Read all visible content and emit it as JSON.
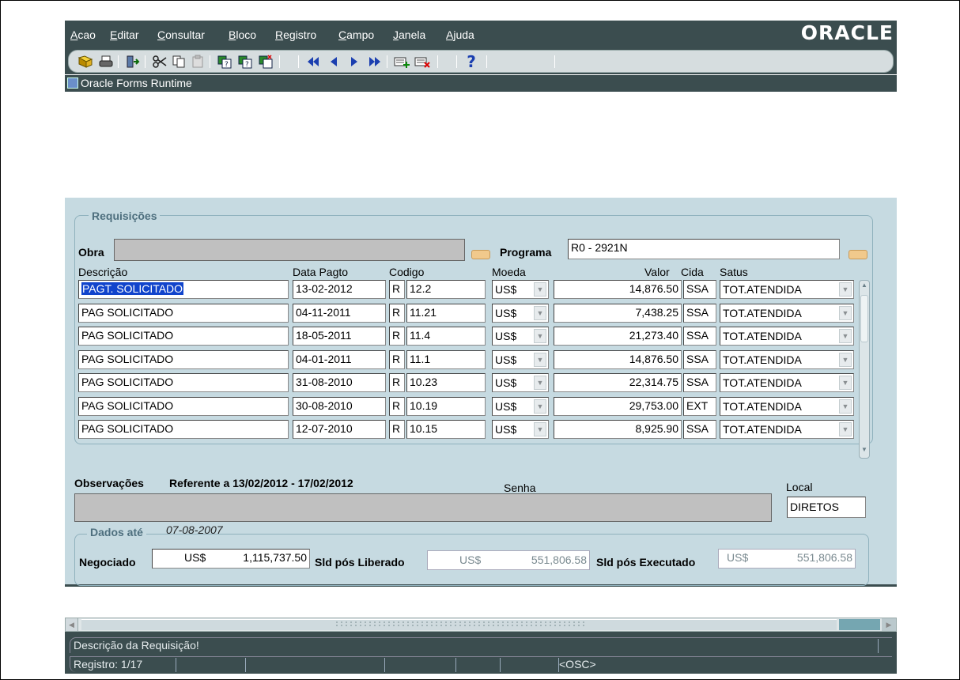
{
  "menu": [
    "Acao",
    "Editar",
    "Consultar",
    "Bloco",
    "Registro",
    "Campo",
    "Janela",
    "Ajuda"
  ],
  "logo": "ORACLE",
  "window_title": "Oracle Forms Runtime",
  "toolbar_icons": [
    "save-icon",
    "print-icon",
    "exit-icon",
    "cut-icon",
    "copy-icon",
    "paste-icon",
    "enter-query-icon",
    "execute-query-icon",
    "cancel-query-icon",
    "first-record-icon",
    "previous-record-icon",
    "next-record-icon",
    "last-record-icon",
    "insert-record-icon",
    "delete-record-icon",
    "help-icon"
  ],
  "help_glyph": "?",
  "requisicoes": {
    "title": "Requisições",
    "obra_label": "Obra",
    "obra_value": "",
    "programa_label": "Programa",
    "programa_value": "R0 - 2921N",
    "headers": {
      "descricao": "Descrição",
      "data": "Data Pagto",
      "codigo": "Codigo",
      "moeda": "Moeda",
      "valor": "Valor",
      "cida": "Cida",
      "satus": "Satus"
    },
    "rows": [
      {
        "descricao": "PAGT. SOLICITADO",
        "data": "13-02-2012",
        "tipo": "R",
        "codigo": "12.2",
        "moeda": "US$",
        "valor": "14,876.50",
        "cida": "SSA",
        "satus": "TOT.ATENDIDA"
      },
      {
        "descricao": "PAG SOLICITADO",
        "data": "04-11-2011",
        "tipo": "R",
        "codigo": "11.21",
        "moeda": "US$",
        "valor": "7,438.25",
        "cida": "SSA",
        "satus": "TOT.ATENDIDA"
      },
      {
        "descricao": "PAG SOLICITADO",
        "data": "18-05-2011",
        "tipo": "R",
        "codigo": "11.4",
        "moeda": "US$",
        "valor": "21,273.40",
        "cida": "SSA",
        "satus": "TOT.ATENDIDA"
      },
      {
        "descricao": "PAG SOLICITADO",
        "data": "04-01-2011",
        "tipo": "R",
        "codigo": "11.1",
        "moeda": "US$",
        "valor": "14,876.50",
        "cida": "SSA",
        "satus": "TOT.ATENDIDA"
      },
      {
        "descricao": "PAG SOLICITADO",
        "data": "31-08-2010",
        "tipo": "R",
        "codigo": "10.23",
        "moeda": "US$",
        "valor": "22,314.75",
        "cida": "SSA",
        "satus": "TOT.ATENDIDA"
      },
      {
        "descricao": "PAG SOLICITADO",
        "data": "30-08-2010",
        "tipo": "R",
        "codigo": "10.19",
        "moeda": "US$",
        "valor": "29,753.00",
        "cida": "EXT",
        "satus": "TOT.ATENDIDA"
      },
      {
        "descricao": "PAG SOLICITADO",
        "data": "12-07-2010",
        "tipo": "R",
        "codigo": "10.15",
        "moeda": "US$",
        "valor": "8,925.90",
        "cida": "SSA",
        "satus": "TOT.ATENDIDA"
      }
    ]
  },
  "observacoes": {
    "label": "Observações",
    "referente": "Referente a 13/02/2012 - 17/02/2012",
    "senha_label": "Senha",
    "local_label": "Local",
    "local_value": "DIRETOS",
    "text_value": ""
  },
  "dados": {
    "title": "Dados até",
    "date": "07-08-2007",
    "negociado_label": "Negociado",
    "negociado_moeda": "US$",
    "negociado_valor": "1,115,737.50",
    "liberado_label": "Sld pós Liberado",
    "liberado_moeda": "US$",
    "liberado_valor": "551,806.58",
    "executado_label": "Sld pós Executado",
    "executado_moeda": "US$",
    "executado_valor": "551,806.58"
  },
  "status": {
    "message": "Descrição da Requisição!",
    "registro": "Registro: 1/17",
    "osc": "<OSC>"
  },
  "colors": {
    "chrome": "#3b4d4f",
    "canvas": "#c6dae1",
    "selection": "#1144cc",
    "lov_button": "#f1c98c"
  }
}
